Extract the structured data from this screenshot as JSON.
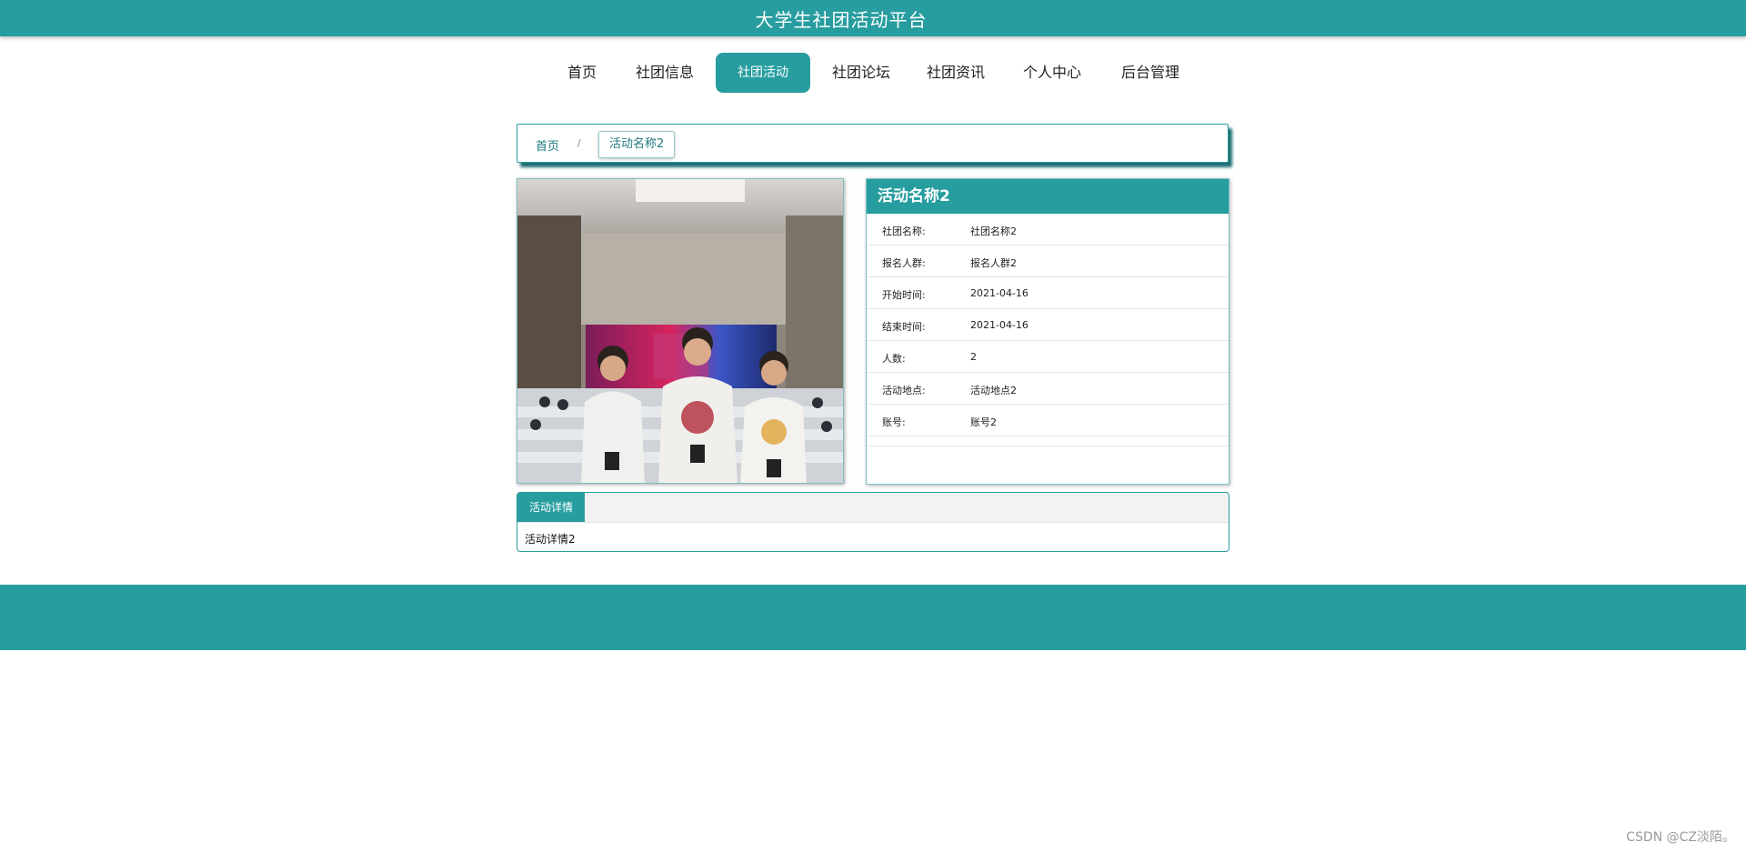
{
  "header": {
    "title": "大学生社团活动平台"
  },
  "nav": {
    "items": [
      {
        "label": "首页"
      },
      {
        "label": "社团信息"
      },
      {
        "label": "社团活动"
      },
      {
        "label": "社团论坛"
      },
      {
        "label": "社团资讯"
      },
      {
        "label": "个人中心"
      },
      {
        "label": "后台管理"
      }
    ],
    "active": "社团活动"
  },
  "breadcrumb": {
    "home": "首页",
    "separator": "/",
    "current": "活动名称2"
  },
  "activity": {
    "title": "活动名称2",
    "fields": [
      {
        "label": "社团名称:",
        "value": "社团名称2"
      },
      {
        "label": "报名人群:",
        "value": "报名人群2"
      },
      {
        "label": "开始时间:",
        "value": "2021-04-16"
      },
      {
        "label": "结束时间:",
        "value": "2021-04-16"
      },
      {
        "label": "人数:",
        "value": "2"
      },
      {
        "label": "活动地点:",
        "value": "活动地点2"
      },
      {
        "label": "账号:",
        "value": "账号2"
      }
    ]
  },
  "detail": {
    "tab_label": "活动详情",
    "content": "活动详情2"
  },
  "watermark": "CSDN @CZ淡陌。",
  "colors": {
    "primary": "#279d9f",
    "border": "#7fbfc1"
  }
}
